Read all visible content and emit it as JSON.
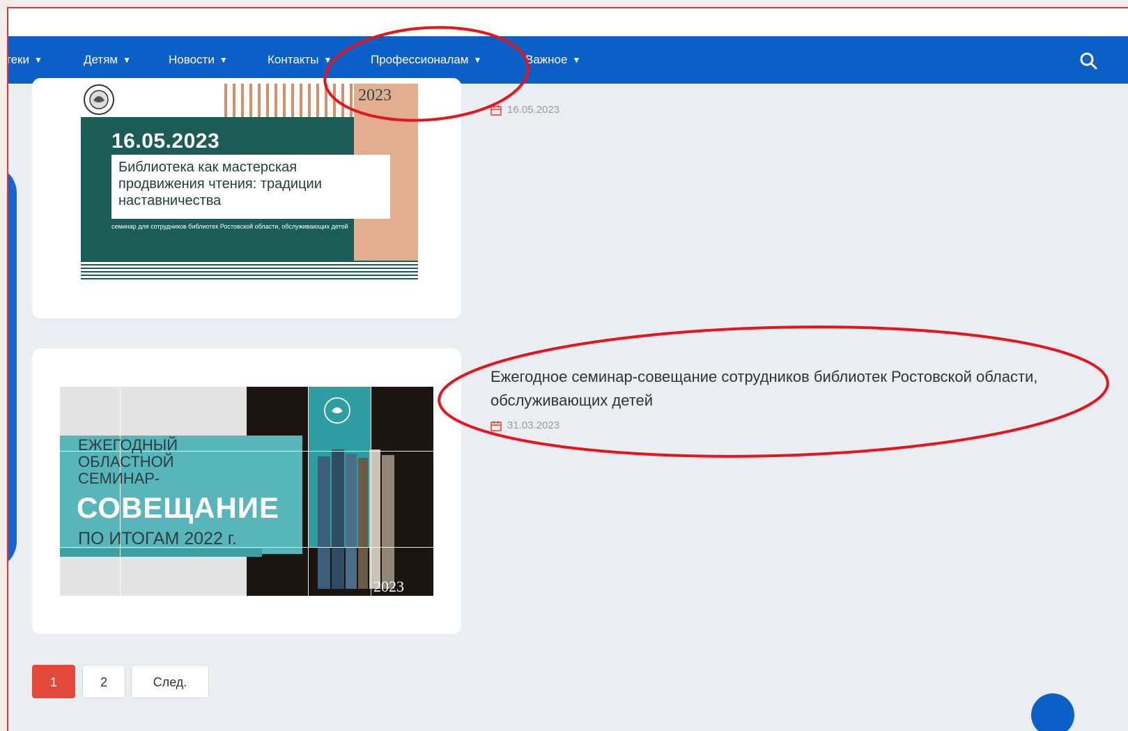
{
  "nav": {
    "items": [
      {
        "label": "теки"
      },
      {
        "label": "Детям"
      },
      {
        "label": "Новости"
      },
      {
        "label": "Контакты"
      },
      {
        "label": "Профессионалам"
      },
      {
        "label": "Важное"
      }
    ],
    "search_icon": "search-icon",
    "chevron_icon": "chevron-down-icon"
  },
  "posts": [
    {
      "date": "16.05.2023",
      "poster": {
        "date": "16.05.2023",
        "title": "Библиотека как мастерская продвижения чтения: традиции наставничества",
        "subtitle": "семинар для сотрудников библиотек Ростовской области, обслуживающих детей",
        "year": "2023"
      }
    },
    {
      "title": "Ежегодное семинар-совещание сотрудников библиотек Ростовской области, обслуживающих детей",
      "date": "31.03.2023",
      "poster": {
        "line1": "ЕЖЕГОДНЫЙ",
        "line2": "ОБЛАСТНОЙ",
        "line3": "СЕМИНАР-",
        "big": "СОВЕЩАНИЕ",
        "line4": "ПО ИТОГАМ 2022 г.",
        "year": "2023"
      }
    }
  ],
  "pagination": {
    "pages": [
      "1",
      "2"
    ],
    "next_label": "След.",
    "active_page": "1"
  },
  "colors": {
    "nav_bg": "#0b5fc7",
    "accent_red": "#e2493b",
    "annotation": "#e8141c"
  }
}
